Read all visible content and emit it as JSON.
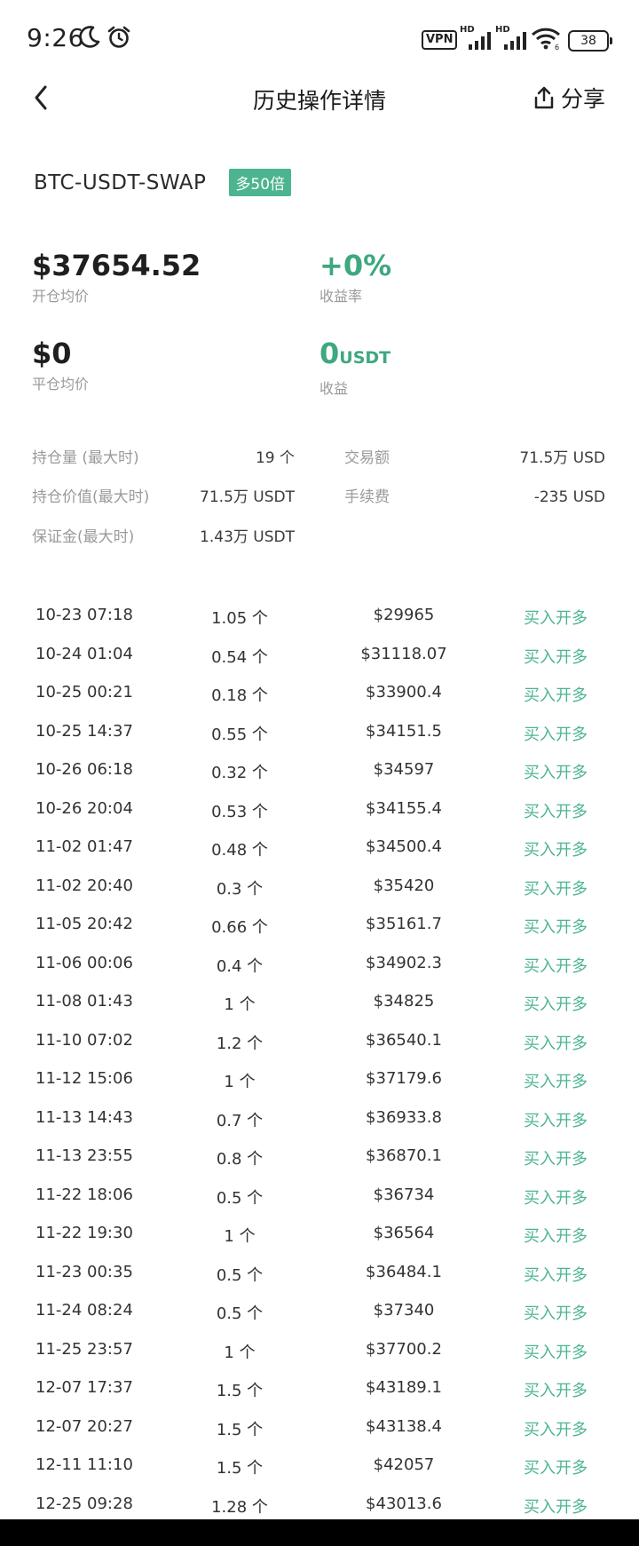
{
  "status_bar": {
    "time": "9:26",
    "vpn": "VPN",
    "hd1": "HD",
    "hd2": "HD",
    "wifi_sub": "6",
    "battery": "38"
  },
  "header": {
    "title": "历史操作详情",
    "share_label": "分享"
  },
  "position": {
    "symbol": "BTC-USDT-SWAP",
    "leverage_badge": "多50倍"
  },
  "metrics": {
    "avg_open_price": {
      "value": "$37654.52",
      "label": "开仓均价"
    },
    "return_rate": {
      "value": "+0%",
      "label": "收益率"
    },
    "avg_close_price": {
      "value": "$0",
      "label": "平仓均价"
    },
    "pnl": {
      "value": "0",
      "unit": "USDT",
      "label": "收益"
    }
  },
  "stats": [
    {
      "label": "持仓量 (最大时)",
      "value": "19 个"
    },
    {
      "label": "交易额",
      "value": "71.5万 USD"
    },
    {
      "label": "持仓价值(最大时)",
      "value": "71.5万 USDT"
    },
    {
      "label": "手续费",
      "value": "-235 USD"
    },
    {
      "label": "保证金(最大时)",
      "value": "1.43万 USDT"
    }
  ],
  "records": [
    {
      "time": "10-23 07:18",
      "qty": "1.05 个",
      "price": "$29965",
      "action": "买入开多"
    },
    {
      "time": "10-24 01:04",
      "qty": "0.54 个",
      "price": "$31118.07",
      "action": "买入开多"
    },
    {
      "time": "10-25 00:21",
      "qty": "0.18 个",
      "price": "$33900.4",
      "action": "买入开多"
    },
    {
      "time": "10-25 14:37",
      "qty": "0.55 个",
      "price": "$34151.5",
      "action": "买入开多"
    },
    {
      "time": "10-26 06:18",
      "qty": "0.32 个",
      "price": "$34597",
      "action": "买入开多"
    },
    {
      "time": "10-26 20:04",
      "qty": "0.53 个",
      "price": "$34155.4",
      "action": "买入开多"
    },
    {
      "time": "11-02 01:47",
      "qty": "0.48 个",
      "price": "$34500.4",
      "action": "买入开多"
    },
    {
      "time": "11-02 20:40",
      "qty": "0.3 个",
      "price": "$35420",
      "action": "买入开多"
    },
    {
      "time": "11-05 20:42",
      "qty": "0.66 个",
      "price": "$35161.7",
      "action": "买入开多"
    },
    {
      "time": "11-06 00:06",
      "qty": "0.4 个",
      "price": "$34902.3",
      "action": "买入开多"
    },
    {
      "time": "11-08 01:43",
      "qty": "1 个",
      "price": "$34825",
      "action": "买入开多"
    },
    {
      "time": "11-10 07:02",
      "qty": "1.2 个",
      "price": "$36540.1",
      "action": "买入开多"
    },
    {
      "time": "11-12 15:06",
      "qty": "1 个",
      "price": "$37179.6",
      "action": "买入开多"
    },
    {
      "time": "11-13 14:43",
      "qty": "0.7 个",
      "price": "$36933.8",
      "action": "买入开多"
    },
    {
      "time": "11-13 23:55",
      "qty": "0.8 个",
      "price": "$36870.1",
      "action": "买入开多"
    },
    {
      "time": "11-22 18:06",
      "qty": "0.5 个",
      "price": "$36734",
      "action": "买入开多"
    },
    {
      "time": "11-22 19:30",
      "qty": "1 个",
      "price": "$36564",
      "action": "买入开多"
    },
    {
      "time": "11-23 00:35",
      "qty": "0.5 个",
      "price": "$36484.1",
      "action": "买入开多"
    },
    {
      "time": "11-24 08:24",
      "qty": "0.5 个",
      "price": "$37340",
      "action": "买入开多"
    },
    {
      "time": "11-25 23:57",
      "qty": "1 个",
      "price": "$37700.2",
      "action": "买入开多"
    },
    {
      "time": "12-07 17:37",
      "qty": "1.5 个",
      "price": "$43189.1",
      "action": "买入开多"
    },
    {
      "time": "12-07 20:27",
      "qty": "1.5 个",
      "price": "$43138.4",
      "action": "买入开多"
    },
    {
      "time": "12-11 11:10",
      "qty": "1.5 个",
      "price": "$42057",
      "action": "买入开多"
    },
    {
      "time": "12-25 09:28",
      "qty": "1.28 个",
      "price": "$43013.6",
      "action": "买入开多"
    }
  ],
  "colors": {
    "accent_green": "#4cb58f",
    "text_primary": "#1f1f1f",
    "text_secondary": "#9a9a9a"
  }
}
